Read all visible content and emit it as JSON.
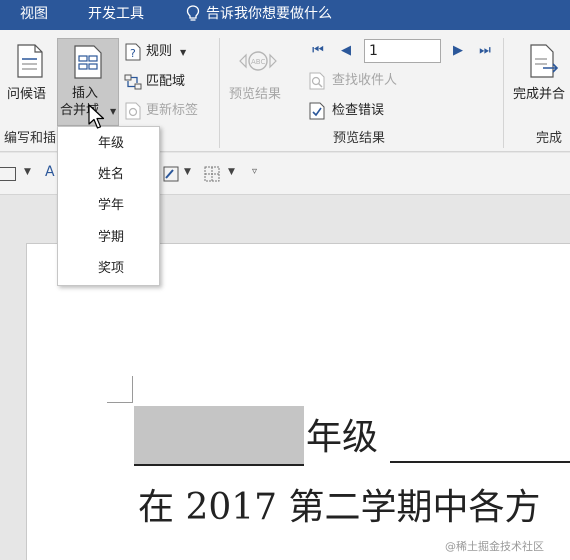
{
  "tabs": {
    "view": "视图",
    "developer": "开发工具"
  },
  "tell_me": "告诉我你想要做什么",
  "ribbon": {
    "greeting_line": "问候语",
    "insert_merge_field": {
      "line1": "插入",
      "line2": "合并域"
    },
    "rules": "规则",
    "match_fields": "匹配域",
    "update_labels": "更新标签",
    "preview_results": "预览结果",
    "record_number": "1",
    "find_recipient": "查找收件人",
    "check_errors": "检查错误",
    "finish_merge": "完成并合",
    "groups": {
      "write_insert": "编写和插",
      "preview_results": "预览结果",
      "finish": "完成"
    }
  },
  "dropdown": {
    "items": [
      "年级",
      "姓名",
      "学年",
      "学期",
      "奖项"
    ]
  },
  "document": {
    "line1_suffix": "年级",
    "line2": "在 2017 第二学期中各方"
  },
  "watermark": "@稀土掘金技术社区",
  "colors": {
    "ribbon_tab_bar": "#2b579a",
    "ribbon": "#f3f3f3",
    "merge_field_shade": "#c5c5c5"
  }
}
